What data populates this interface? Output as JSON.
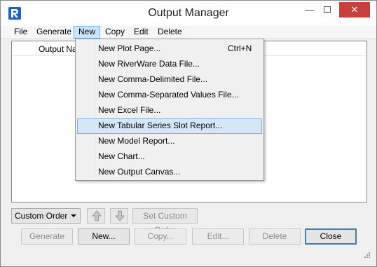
{
  "window": {
    "title": "Output Manager",
    "minimize": "—",
    "close": "✕"
  },
  "menubar": {
    "items": [
      "File",
      "Generate",
      "New",
      "Copy",
      "Edit",
      "Delete"
    ]
  },
  "list": {
    "column_header": "Output Na"
  },
  "new_menu": {
    "items": [
      {
        "label": "New Plot Page...",
        "shortcut": "Ctrl+N"
      },
      {
        "label": "New RiverWare Data File..."
      },
      {
        "label": "New Comma-Delimited File..."
      },
      {
        "label": "New Comma-Separated Values File..."
      },
      {
        "label": "New Excel File..."
      },
      {
        "label": "New Tabular Series Slot Report..."
      },
      {
        "label": "New Model Report..."
      },
      {
        "label": "New Chart..."
      },
      {
        "label": "New Output Canvas..."
      }
    ],
    "highlighted_index": 5
  },
  "ordering": {
    "combo_value": "Custom Order",
    "up_icon": "arrow-up-icon",
    "down_icon": "arrow-down-icon",
    "set_order_label": "Set Custom Order"
  },
  "buttons": {
    "generate": "Generate",
    "new": "New...",
    "copy": "Copy...",
    "edit": "Edit...",
    "delete": "Delete",
    "close": "Close"
  },
  "colors": {
    "accent": "#1f5fc8",
    "close_red": "#c7413c",
    "highlight": "#d5e6f6"
  }
}
